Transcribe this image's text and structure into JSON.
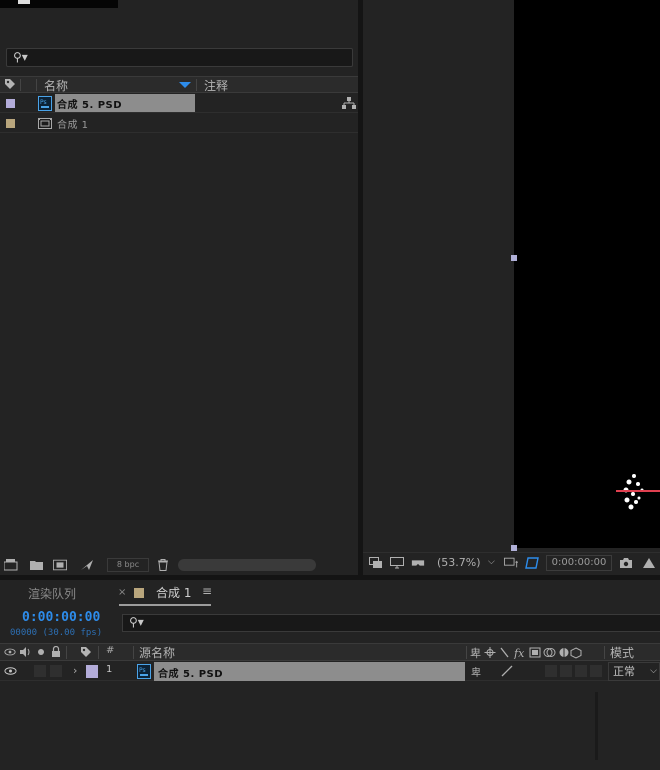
{
  "project": {
    "header": {
      "name_label": "名称",
      "comment_label": "注释"
    },
    "items": [
      {
        "name": "合成 5. PSD",
        "swatch": "#b3acd9",
        "icon": "psd-file-icon"
      },
      {
        "name": "合成 1",
        "swatch": "#b9a67d",
        "icon": "composition-icon"
      }
    ],
    "footer": {
      "bpc": "8 bpc"
    }
  },
  "viewer": {
    "zoom": "(53.7%)",
    "timecode": "0:00:00:00"
  },
  "timeline": {
    "tabs": {
      "render_queue": "渲染队列",
      "comp": "合成 1",
      "close": "×",
      "menu": "≡"
    },
    "timecode": "0:00:00:00",
    "frames": "00000 (30.00 fps)",
    "header": {
      "hash": "#",
      "source_name": "源名称",
      "mode": "模式"
    },
    "layer": {
      "number": "1",
      "name": "合成 5. PSD",
      "mode": "正常",
      "expand": "›",
      "switch": "卑"
    }
  },
  "colors": {
    "accent": "#2d8ceb",
    "selected_row": "#8d8d8d"
  }
}
